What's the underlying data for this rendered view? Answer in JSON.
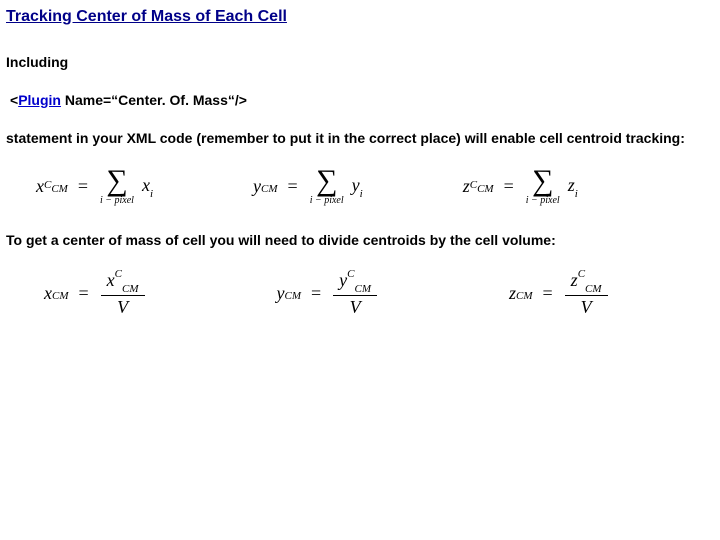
{
  "title": "Tracking Center of Mass of Each Cell",
  "para_including": "Including",
  "code": {
    "lt": "<",
    "plugin": "Plugin",
    "rest": " Name=“Center. Of. Mass“/>"
  },
  "para_after_code": "statement in your XML code (remember to put it in the correct place) will enable cell centroid tracking:",
  "para_divide": "To get a center of mass of cell you will need to divide centroids by the cell volume:",
  "sigma_limit": "i − pixel",
  "vars": {
    "x": "x",
    "y": "y",
    "z": "z",
    "C": "C",
    "CM": "CM",
    "V": "V",
    "i": "i"
  }
}
